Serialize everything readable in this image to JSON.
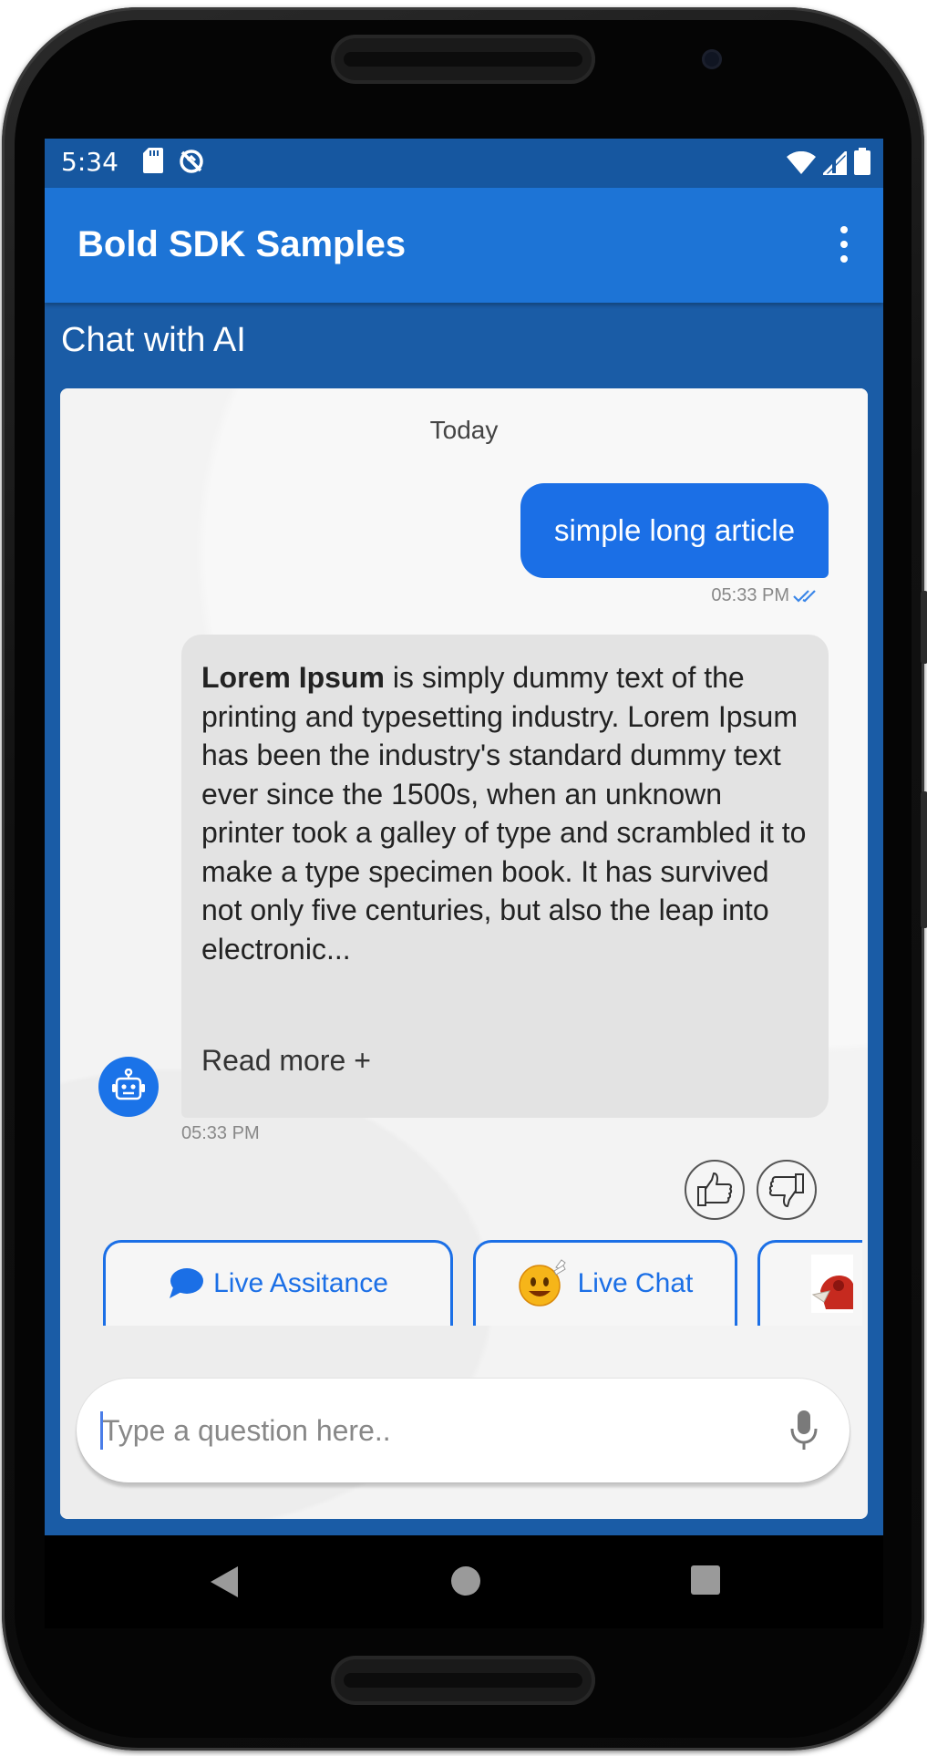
{
  "status_bar": {
    "time": "5:34"
  },
  "app_bar": {
    "title": "Bold SDK Samples"
  },
  "section": {
    "title": "Chat with AI"
  },
  "chat": {
    "date_label": "Today",
    "user_message": {
      "text": "simple long article",
      "time": "05:33 PM"
    },
    "bot_message": {
      "bold_lead": "Lorem Ipsum",
      "text": " is simply dummy text of the printing and typesetting industry. Lorem Ipsum has been the industry's standard dummy text ever since the 1500s, when an unknown printer took a galley of type and scrambled it to make a type specimen book. It has survived not only five centuries, but also the leap into electronic...",
      "read_more": "Read more +",
      "time": "05:33 PM"
    },
    "quick_replies": [
      {
        "label": "Live Assitance",
        "icon": "chat-bubble-icon"
      },
      {
        "label": "Live Chat",
        "icon": "waving-smiley-icon"
      },
      {
        "label": "",
        "icon": "character-image-icon"
      }
    ]
  },
  "input": {
    "placeholder": "Type a question here..",
    "value": ""
  },
  "colors": {
    "status_bar": "#1657a0",
    "app_bar": "#1d74d6",
    "screen_bg": "#1a5ca6",
    "user_bubble": "#1b6fe6",
    "bot_bubble": "#e3e3e3",
    "accent": "#1b6fe6"
  }
}
